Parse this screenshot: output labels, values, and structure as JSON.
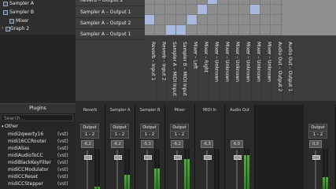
{
  "graph_tree": {
    "items": [
      {
        "label": "Sampler A",
        "indent": 2
      },
      {
        "label": "Sampler B",
        "indent": 2
      },
      {
        "label": "Mixer",
        "indent": 2
      },
      {
        "label": "Graph 2",
        "indent": 1
      }
    ]
  },
  "plugins": {
    "header": "Plugins",
    "search_placeholder": "Search...",
    "category": "Other",
    "items": [
      {
        "name": "midi2qwerty16",
        "tag": "(vst)"
      },
      {
        "name": "midi16CCRouter",
        "tag": "(vst)"
      },
      {
        "name": "midiAlias",
        "tag": "(vst)"
      },
      {
        "name": "midiAudioToCC",
        "tag": "(vst)"
      },
      {
        "name": "midiBlackKeyFilter",
        "tag": "(vst)"
      },
      {
        "name": "midiCCModulator",
        "tag": "(vst)"
      },
      {
        "name": "midiCCReset",
        "tag": "(vst)"
      },
      {
        "name": "midiCCStepper",
        "tag": "(vst)"
      }
    ]
  },
  "matrix": {
    "rows": [
      "Reverb – Output 2",
      "Sampler A – Output 1",
      "Sampler A – Output 2",
      "Sampler A – Output 1"
    ],
    "columns": [
      "Reverb – Input 1",
      "Reverb – Input 2",
      "Sampler A – MIDI Input",
      "Sampler B – MIDI Input",
      "Mixer – Left",
      "Mixer – Right",
      "Mixer – Unknown",
      "Mixer – Unknown",
      "Mixer – Unknown",
      "Mixer – Unknown",
      "Mixer – Unknown",
      "Mixer – Unknown",
      "Audio Out – Output 2",
      "Audio Out – Output 1"
    ],
    "active_cells": [
      [
        0,
        6
      ],
      [
        1,
        5
      ],
      [
        1,
        10
      ],
      [
        2,
        0
      ],
      [
        2,
        4
      ],
      [
        3,
        2
      ],
      [
        3,
        3
      ]
    ],
    "active_color": "#a8b8de"
  },
  "mixer": {
    "strips": [
      {
        "name": "Reverb",
        "output": "Output",
        "channel": "1 – 2",
        "value": "-6.2",
        "level": 0.05
      },
      {
        "name": "Sampler A",
        "output": "Output",
        "channel": "1 – 2",
        "value": "-6.2",
        "level": 0.35
      },
      {
        "name": "Sampler B",
        "output": "Output",
        "channel": "1 – 2",
        "value": "-5.3",
        "level": 0.5
      },
      {
        "name": "Mixer",
        "output": "Output",
        "channel": "1 – 2",
        "value": "-6.2",
        "level": 0.75
      },
      {
        "name": "MIDI In",
        "output": "",
        "channel": "",
        "value": "-6.3",
        "level": 0.0
      },
      {
        "name": "Audio Out",
        "output": "",
        "channel": "",
        "value": "6.0",
        "level": 0.85
      },
      {
        "name": "",
        "output": "Output",
        "channel": "1 – 2",
        "value": "0.3",
        "level": 0.3
      }
    ],
    "meter_color": "#5ca34a"
  }
}
